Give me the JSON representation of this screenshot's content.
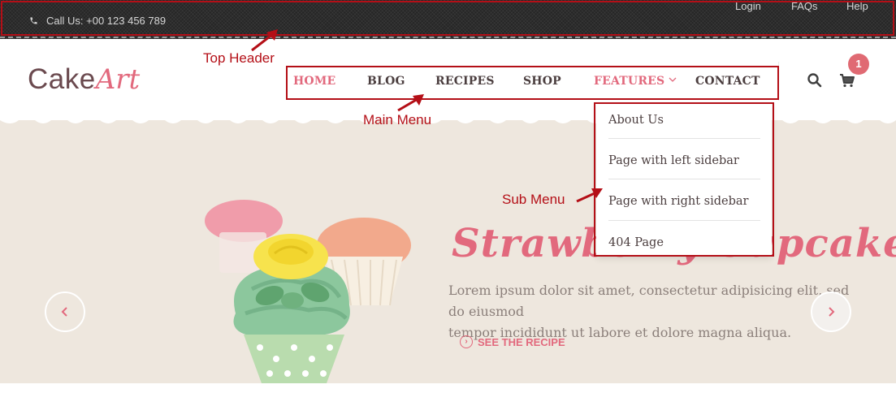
{
  "top_header": {
    "phone_text": "Call Us: +00 123 456 789",
    "links": [
      "Login",
      "FAQs",
      "Help"
    ]
  },
  "logo": {
    "part1": "Cake",
    "part2": "Art"
  },
  "nav": {
    "items": [
      "HOME",
      "BLOG",
      "RECIPES",
      "SHOP",
      "FEATURES",
      "CONTACT"
    ],
    "active": "HOME"
  },
  "cart": {
    "count": "1"
  },
  "submenu": {
    "items": [
      "About Us",
      "Page with left sidebar",
      "Page with right sidebar",
      "404 Page"
    ]
  },
  "slide": {
    "title": "Strawberry Cupcake",
    "text_line1": "Lorem ipsum dolor sit amet, consectetur adipisicing elit, sed do eiusmod",
    "text_line2": "tempor incididunt ut labore et dolore magna aliqua.",
    "cta": "SEE THE RECIPE"
  },
  "annotations": {
    "top_header": "Top Header",
    "main_menu": "Main Menu",
    "sub_menu": "Sub Menu"
  },
  "colors": {
    "accent": "#e2697d",
    "annotation": "#b40f17",
    "top_bar": "#262626",
    "hero_bg": "#eee7de",
    "badge": "#e06a73"
  },
  "icons": [
    "phone-icon",
    "search-icon",
    "cart-icon",
    "chevron-down-icon",
    "chevron-left-icon",
    "chevron-right-icon"
  ]
}
